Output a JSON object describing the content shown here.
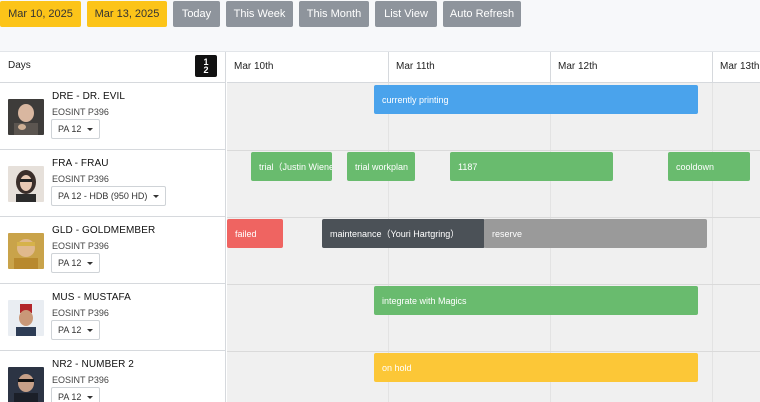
{
  "toolbar": {
    "start_date": "Mar 10, 2025",
    "end_date": "Mar 13, 2025",
    "today": "Today",
    "this_week": "This Week",
    "this_month": "This Month",
    "list_view": "List View",
    "auto_refresh": "Auto Refresh"
  },
  "header": {
    "days_label": "Days",
    "sort_top": "1",
    "sort_bottom": "2",
    "days": [
      "Mar 10th",
      "Mar 11th",
      "Mar 12th",
      "Mar 13th"
    ]
  },
  "resources": [
    {
      "code_name": "DRE - DR. EVIL",
      "model": "EOSINT P396",
      "material": "PA 12"
    },
    {
      "code_name": "FRA - FRAU",
      "model": "EOSINT P396",
      "material": "PA 12 - HDB (950 HD)"
    },
    {
      "code_name": "GLD - GOLDMEMBER",
      "model": "EOSINT P396",
      "material": "PA 12"
    },
    {
      "code_name": "MUS - MUSTAFA",
      "model": "EOSINT P396",
      "material": "PA 12"
    },
    {
      "code_name": "NR2 - NUMBER 2",
      "model": "EOSINT P396",
      "material": "PA 12"
    }
  ],
  "events": [
    {
      "label": "currently printing",
      "color": "#4aa3ec"
    },
    {
      "label": "trial（Justin Wiener）",
      "color": "#69bb6e"
    },
    {
      "label": "trial workplan",
      "color": "#69bb6e"
    },
    {
      "label": "1187",
      "color": "#69bb6e"
    },
    {
      "label": "cooldown",
      "color": "#69bb6e"
    },
    {
      "label": "failed",
      "color": "#ef6461"
    },
    {
      "label": "maintenance（Youri Hartgring）",
      "color": "#4b5157"
    },
    {
      "label": "reserve",
      "color": "#9a9a9a"
    },
    {
      "label": "integrate with Magics",
      "color": "#69bb6e"
    },
    {
      "label": "on hold",
      "color": "#fcc737"
    }
  ],
  "colors": {
    "date_buttons": "#fcc419",
    "view_buttons": "#8e949c",
    "grid_background": "#f0f0f0"
  },
  "icons": {
    "sort": "sort-numeric-icon",
    "dropdown": "caret-down-icon"
  }
}
